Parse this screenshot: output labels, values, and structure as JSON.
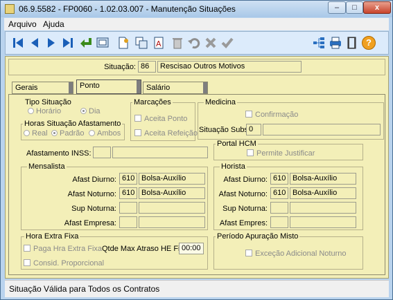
{
  "window": {
    "title": "06.9.5582 - FP0060 - 1.02.03.007 - Manutenção Situações",
    "minimize": "–",
    "maximize": "□",
    "close": "x"
  },
  "menu": {
    "arquivo": "Arquivo",
    "ajuda": "Ajuda"
  },
  "toolbar": {
    "icons": [
      "first-icon",
      "prev-icon",
      "next-icon",
      "last-icon",
      "enter-icon",
      "zoom-icon",
      "add-icon",
      "copy-icon",
      "edit-icon",
      "delete-icon",
      "undo-icon",
      "cancel-icon",
      "confirm-icon",
      "tree-icon",
      "print-icon",
      "exit-icon",
      "help-icon"
    ],
    "help_label": "?"
  },
  "header": {
    "label": "Situação:",
    "code": "86",
    "description": "Rescisao Outros Motivos"
  },
  "tabs": [
    {
      "label": "Gerais"
    },
    {
      "label": "Ponto"
    },
    {
      "label": "Salário"
    }
  ],
  "tipo_situacao": {
    "title": "Tipo Situação",
    "horario": "Horário",
    "dia": "Dia",
    "selected": "Dia"
  },
  "horas_afastamento": {
    "title": "Horas Situação Afastamento",
    "real": "Real",
    "padrao": "Padrão",
    "ambos": "Ambos",
    "selected": "Padrão"
  },
  "marcacoes": {
    "title": "Marcações",
    "aceita_ponto": "Aceita Ponto",
    "aceita_refeicao": "Aceita Refeição"
  },
  "medicina": {
    "title": "Medicina",
    "confirmacao": "Confirmação",
    "situacao_subst_label": "Situação Subst:",
    "situacao_subst_value": "0",
    "situacao_subst_desc": ""
  },
  "afastamento_inss": {
    "label": "Afastamento INSS:",
    "code": "",
    "desc": ""
  },
  "portal_hcm": {
    "title": "Portal HCM",
    "permite_justificar": "Permite Justificar"
  },
  "mensalista": {
    "title": "Mensalista",
    "rows": [
      {
        "label": "Afast Diurno:",
        "code": "610",
        "desc": "Bolsa-Auxílio"
      },
      {
        "label": "Afast Noturno:",
        "code": "610",
        "desc": "Bolsa-Auxílio"
      },
      {
        "label": "Sup Noturna:",
        "code": "",
        "desc": ""
      },
      {
        "label": "Afast Empresa:",
        "code": "",
        "desc": ""
      }
    ]
  },
  "horista": {
    "title": "Horista",
    "rows": [
      {
        "label": "Afast Diurno:",
        "code": "610",
        "desc": "Bolsa-Auxílio"
      },
      {
        "label": "Afast Noturno:",
        "code": "610",
        "desc": "Bolsa-Auxílio"
      },
      {
        "label": "Sup Noturna:",
        "code": "",
        "desc": ""
      },
      {
        "label": "Afast Empres:",
        "code": "",
        "desc": ""
      }
    ]
  },
  "hora_extra": {
    "title": "Hora Extra Fixa",
    "paga": "Paga Hra Extra Fixa",
    "consid": "Consid. Proporcional",
    "qtde_label": "Qtde Max Atraso HE Fixa:",
    "qtde_value": "00:00"
  },
  "periodo_misto": {
    "title": "Período Apuração Misto",
    "excecao": "Exceção Adicional Noturno"
  },
  "status": "Situação Válida para Todos os Contratos"
}
